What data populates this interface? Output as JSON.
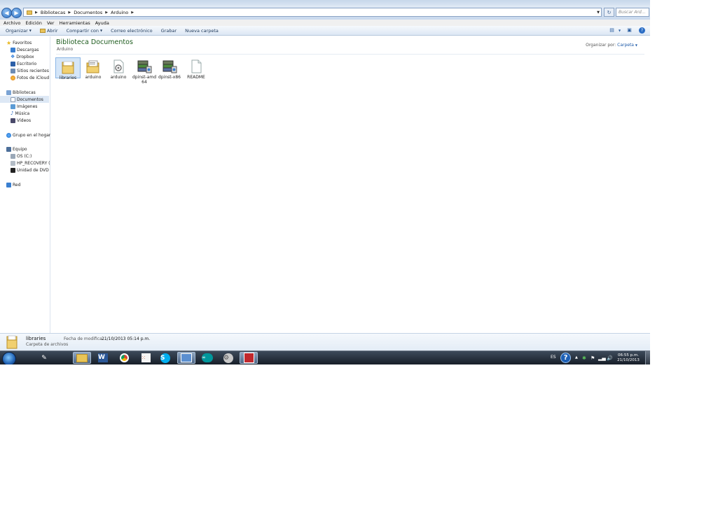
{
  "address_bar": {
    "breadcrumb": [
      "Bibliotecas",
      "Documentos",
      "Arduino"
    ],
    "search_placeholder": "Buscar Ard..."
  },
  "menu": [
    "Archivo",
    "Edición",
    "Ver",
    "Herramientas",
    "Ayuda"
  ],
  "toolbar": {
    "organize": "Organizar",
    "open": "Abrir",
    "share": "Compartir con",
    "email": "Correo electrónico",
    "burn": "Grabar",
    "new_folder": "Nueva carpeta"
  },
  "nav": {
    "favorites": "Favoritos",
    "downloads": "Descargas",
    "dropbox": "Dropbox",
    "desktop": "Escritorio",
    "recent": "Sitios recientes",
    "icloud": "Fotos de iCloud",
    "libraries": "Bibliotecas",
    "documents": "Documentos",
    "images": "Imágenes",
    "music": "Música",
    "videos": "Vídeos",
    "homegroup": "Grupo en el hogar",
    "computer": "Equipo",
    "os_c": "OS (C:)",
    "hp_recovery": "HP_RECOVERY (D:",
    "dvd": "Unidad de DVD RV",
    "network": "Red"
  },
  "content": {
    "library_title": "Biblioteca Documentos",
    "library_sub": "Arduino",
    "arrange_label": "Organizar por:",
    "arrange_value": "Carpeta",
    "files": [
      {
        "name": "libraries",
        "icon": "folder-icon"
      },
      {
        "name": "arduino",
        "icon": "folder-files-icon"
      },
      {
        "name": "arduino",
        "icon": "app-file-icon"
      },
      {
        "name": "dpinst-amd 64",
        "icon": "installer-icon"
      },
      {
        "name": "dpinst-x86",
        "icon": "installer-icon"
      },
      {
        "name": "README",
        "icon": "text-file-icon"
      }
    ]
  },
  "details": {
    "name": "libraries",
    "type": "Carpeta de archivos",
    "modified_label": "Fecha de modifica...",
    "modified_value": "21/10/2013 05:14 p.m."
  },
  "taskbar": {
    "language": "ES",
    "help": "?",
    "time": "06:55 p.m.",
    "date": "21/10/2013",
    "apps": [
      "explorer",
      "word",
      "chrome",
      "apps-grid",
      "skype",
      "remote",
      "arduino",
      "settings",
      "pdf"
    ]
  }
}
